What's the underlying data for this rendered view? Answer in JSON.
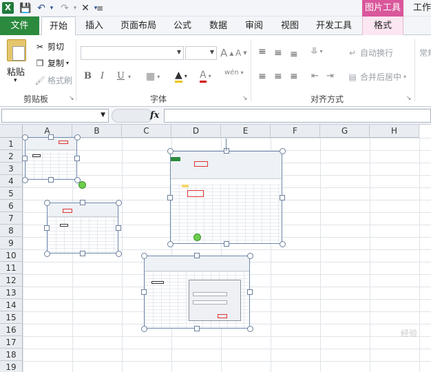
{
  "qat": {
    "app_icon": "X",
    "icons": [
      "save-icon",
      "undo-icon",
      "redo-icon",
      "tools-icon",
      "customize-icon"
    ]
  },
  "context": {
    "picture_tools": "图片工具",
    "work": "工作"
  },
  "tabs": [
    {
      "label": "文件"
    },
    {
      "label": "开始"
    },
    {
      "label": "插入"
    },
    {
      "label": "页面布局"
    },
    {
      "label": "公式"
    },
    {
      "label": "数据"
    },
    {
      "label": "审阅"
    },
    {
      "label": "视图"
    },
    {
      "label": "开发工具"
    },
    {
      "label": "格式"
    }
  ],
  "ribbon": {
    "clipboard": {
      "paste": "粘贴",
      "cut": "剪切",
      "copy": "复制",
      "format_painter": "格式刷",
      "label": "剪贴板"
    },
    "font": {
      "label": "字体",
      "bold": "B",
      "italic": "I",
      "underline": "U",
      "grow": "A",
      "shrink": "A",
      "color_a": "A",
      "phonetic": "wén"
    },
    "alignment": {
      "label": "对齐方式",
      "wrap": "自动换行",
      "merge": "合并后居中"
    },
    "number": {
      "general": "常规"
    }
  },
  "formula_bar": {
    "name_box": "",
    "fx": "fx",
    "formula": ""
  },
  "columns": [
    "A",
    "B",
    "C",
    "D",
    "E",
    "F",
    "G",
    "H"
  ],
  "rows": [
    "1",
    "2",
    "3",
    "4",
    "5",
    "6",
    "7",
    "8",
    "9",
    "10",
    "11",
    "12",
    "13",
    "14",
    "15",
    "16",
    "17",
    "18",
    "19"
  ],
  "watermark": "经验"
}
